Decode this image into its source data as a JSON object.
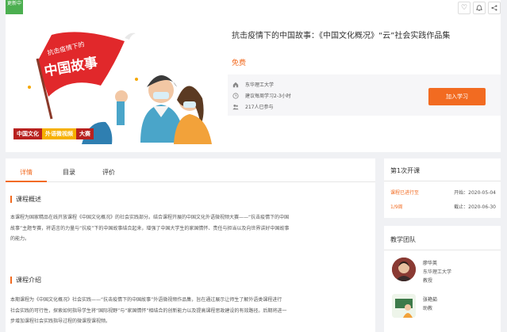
{
  "badge": {
    "text": "更新中"
  },
  "banner": {
    "flag_top": "抗击疫情下的",
    "flag_main": "中国故事",
    "bottom_left": "中国文化",
    "bottom_mid": "外语微视频",
    "bottom_right": "大赛"
  },
  "course": {
    "title": "抗击疫情下的中国故事：《中国文化概况》“云”社会实践作品集",
    "price": "免费",
    "school": "东华理工大学",
    "hours": "建议每周学习2-3小时",
    "enrolled": "217人已参与",
    "join_label": "加入学习"
  },
  "tabs": [
    {
      "label": "详情"
    },
    {
      "label": "目录"
    },
    {
      "label": "评价"
    }
  ],
  "overview": {
    "title": "课程概述",
    "lines": [
      "本课程为国家精品在线开放课程《中国文化概况》的社会实践部分。结合课程开展的中国文化外语微视频大赛——“抗击疫情下的中国",
      "故事”主题专赛，将语言的力量与“抗疫”下的中国故事结合起来，增强了中国大学生的家国情怀、责任与担当以及向世界讲好中国故事",
      "的能力。"
    ]
  },
  "intro": {
    "title": "课程介绍",
    "lines": [
      "本期课程为《中国文化概况》社会实践——“抗击疫情下的中国故事”外语微视频作品集，旨在通过展示让师生了解外语类课程进行",
      "社会实践的可行性，探索如何指导学生将“国际视野”与“家国情怀”相结合的创新能力以及提高课程思政建设的有效路径。后期将进一",
      "步增加课程社会实践指导过程的微课授课视频。"
    ]
  },
  "session": {
    "title": "第1次开课",
    "status": "课程已进行至",
    "progress": "1/9周",
    "start": "开始：2020-05-04",
    "end": "截止：2020-06-30"
  },
  "team": {
    "title": "教学团队",
    "members": [
      {
        "name": "廖华英",
        "org": "东华理工大学",
        "role": "教授"
      },
      {
        "name": "张艳茹",
        "org": "",
        "role": "助教"
      }
    ]
  }
}
